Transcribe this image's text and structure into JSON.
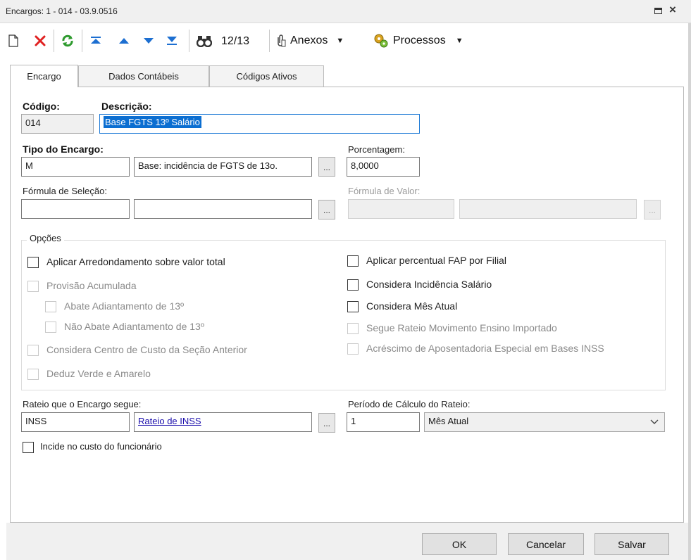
{
  "window": {
    "title": "Encargos: 1 - 014 - 03.9.0516"
  },
  "toolbar": {
    "record_counter": "12/13",
    "anexos_label": "Anexos",
    "processos_label": "Processos",
    "dropdown_glyph": "▼"
  },
  "tabs": [
    {
      "label": "Encargo",
      "active": true
    },
    {
      "label": "Dados Contábeis",
      "active": false
    },
    {
      "label": "Códigos Ativos",
      "active": false
    }
  ],
  "form": {
    "codigo_label": "Código:",
    "codigo_value": "014",
    "descricao_label": "Descrição:",
    "descricao_value": "Base FGTS 13º Salário",
    "tipo_label": "Tipo do Encargo:",
    "tipo_code": "M",
    "tipo_desc": "Base: incidência de FGTS de 13o.",
    "porcentagem_label": "Porcentagem:",
    "porcentagem_value": "8,0000",
    "formula_selecao_label": "Fórmula de Seleção:",
    "formula_selecao_code": "",
    "formula_selecao_desc": "",
    "formula_valor_label": "Fórmula de Valor:",
    "formula_valor_code": "",
    "formula_valor_desc": "",
    "ellipsis": "...",
    "rateio_label": "Rateio que o Encargo segue:",
    "rateio_code": "INSS",
    "rateio_link": "Rateio de INSS",
    "periodo_label": "Período de Cálculo do Rateio:",
    "periodo_value": "1",
    "periodo_select": "Mês Atual",
    "incide_label": "Incide no custo do funcionário",
    "incide_checked": false
  },
  "opcoes": {
    "title": "Opções",
    "left": [
      {
        "label": "Aplicar Arredondamento sobre valor total",
        "checked": false,
        "enabled": true
      },
      {
        "label": "Provisão Acumulada",
        "checked": false,
        "enabled": false
      },
      {
        "label": "Abate Adiantamento de 13º",
        "checked": false,
        "enabled": false
      },
      {
        "label": "Não Abate Adiantamento de 13º",
        "checked": false,
        "enabled": false
      },
      {
        "label": "Considera Centro de Custo da Seção Anterior",
        "checked": false,
        "enabled": false
      },
      {
        "label": "Deduz Verde e Amarelo",
        "checked": false,
        "enabled": false
      }
    ],
    "right": [
      {
        "label": "Aplicar percentual FAP por Filial",
        "checked": false,
        "enabled": true
      },
      {
        "label": "Considera Incidência Salário",
        "checked": false,
        "enabled": true
      },
      {
        "label": "Considera Mês Atual",
        "checked": false,
        "enabled": true
      },
      {
        "label": "Segue Rateio Movimento Ensino Importado",
        "checked": false,
        "enabled": false
      },
      {
        "label": "Acréscimo de Aposentadoria Especial em Bases INSS",
        "checked": false,
        "enabled": false
      }
    ]
  },
  "buttons": {
    "ok": "OK",
    "cancelar": "Cancelar",
    "salvar": "Salvar"
  },
  "colors": {
    "delete_icon": "#e02020",
    "refresh_icon": "#2e9a2e",
    "nav_icon": "#1d6fd1",
    "selection": "#0b6ed1",
    "link": "#1a0dab"
  }
}
